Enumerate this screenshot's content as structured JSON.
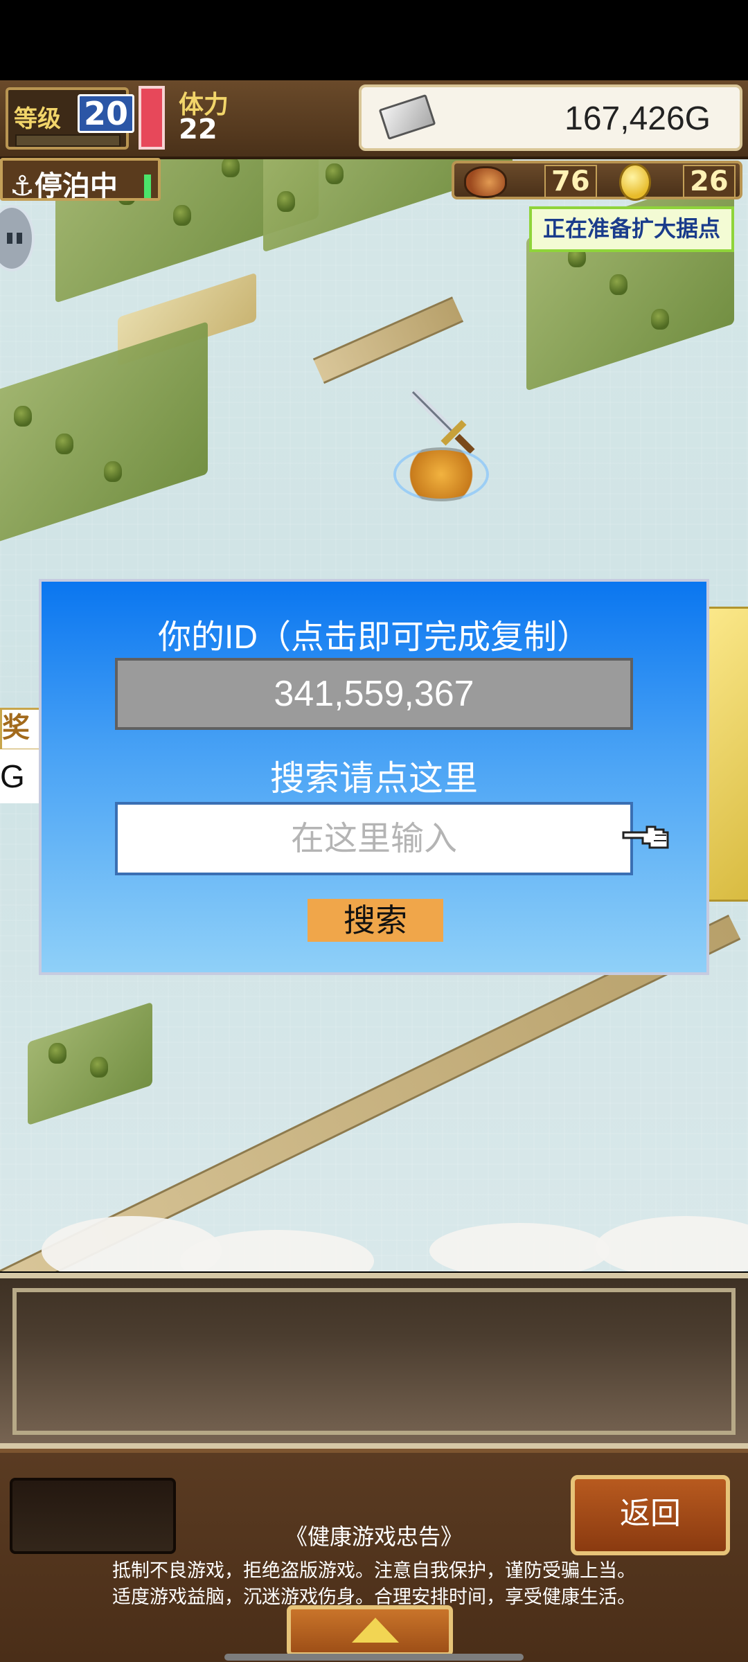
{
  "header": {
    "level_label": "等级",
    "level_value": "20",
    "stamina_label": "体力",
    "stamina_value": "22",
    "money": "167,426G"
  },
  "status_row": {
    "anchor_label": "停泊中",
    "meat_count": "76",
    "coin_count": "26"
  },
  "map": {
    "expand_note": "正在准备扩大据点",
    "left_tag_partial": "奖历",
    "left_tag_g": "G"
  },
  "dialog": {
    "title": "你的ID（点击即可完成复制）",
    "player_id": "341,559,367",
    "search_label": "搜索请点这里",
    "search_placeholder": "在这里输入",
    "search_button": "搜索"
  },
  "footer": {
    "return_button": "返回",
    "advice_title": "《健康游戏忠告》",
    "advice_line1": "抵制不良游戏，拒绝盗版游戏。注意自我保护，谨防受骗上当。",
    "advice_line2": "适度游戏益脑，沉迷游戏伤身。合理安排时间，享受健康生活。"
  },
  "colors": {
    "dialog_top": "#0a76f0",
    "dialog_bottom": "#8fd0f8",
    "search_button": "#f0a64a",
    "expand_note_border": "#8fd43a"
  }
}
